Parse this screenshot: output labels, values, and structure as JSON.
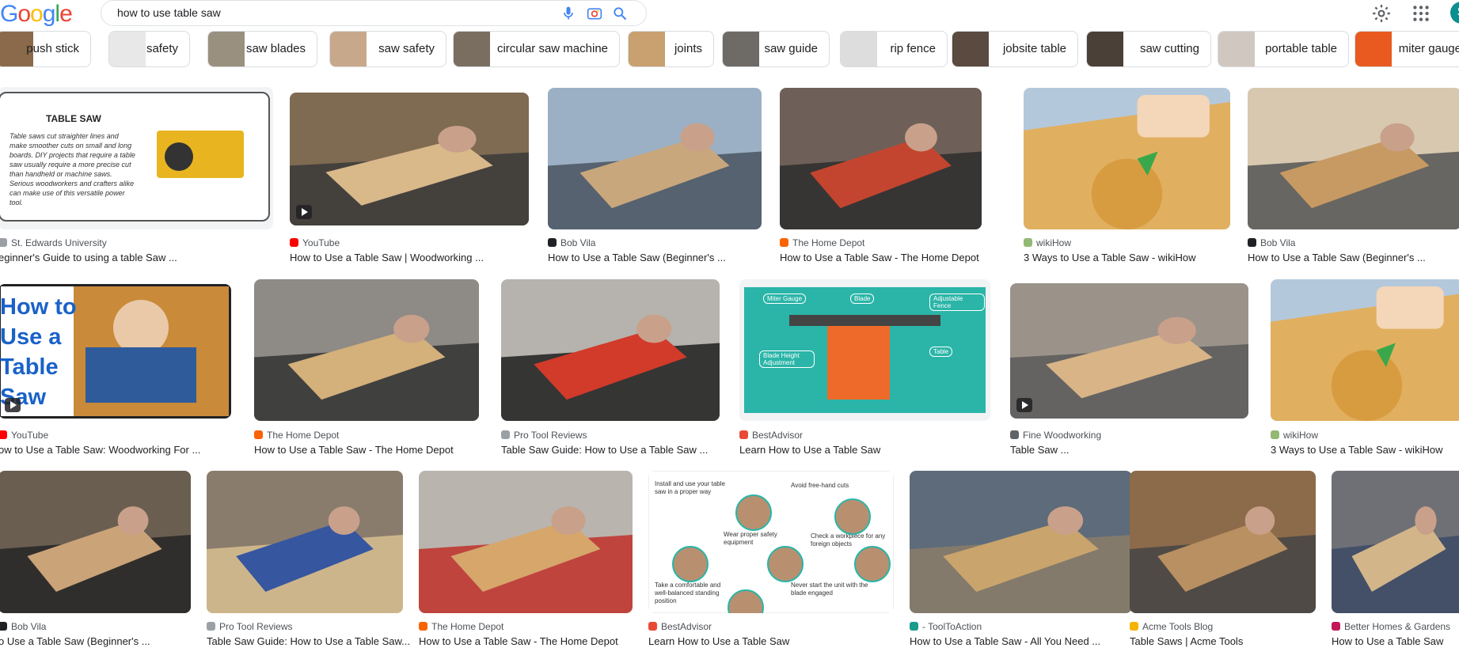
{
  "header": {
    "logo_letters": [
      "G",
      "o",
      "o",
      "g",
      "l",
      "e"
    ],
    "logo_colors": [
      "#4285f4",
      "#ea4335",
      "#fbbc05",
      "#4285f4",
      "#34a853",
      "#ea4335"
    ],
    "search_value": "how to use table saw",
    "avatar_letter": "S",
    "icons": [
      "mic-icon",
      "camera-search-icon",
      "search-icon",
      "gear-icon",
      "apps-grid-icon"
    ]
  },
  "chips": [
    {
      "label": "push stick"
    },
    {
      "label": "safety"
    },
    {
      "label": "saw blades"
    },
    {
      "label": "saw safety"
    },
    {
      "label": "circular saw machine"
    },
    {
      "label": "joints"
    },
    {
      "label": "saw guide"
    },
    {
      "label": "rip fence"
    },
    {
      "label": "jobsite table"
    },
    {
      "label": "saw cutting"
    },
    {
      "label": "portable table"
    },
    {
      "label": "miter gauge"
    }
  ],
  "results": [
    {
      "source": "St. Edwards University",
      "title": "eginner's Guide to using a table Saw ...",
      "favicon": "#9aa0a6"
    },
    {
      "source": "YouTube",
      "title": "How to Use a Table Saw | Woodworking ...",
      "favicon": "#ff0000"
    },
    {
      "source": "Bob Vila",
      "title": "How to Use a Table Saw (Beginner's ...",
      "favicon": "#202124"
    },
    {
      "source": "The Home Depot",
      "title": "How to Use a Table Saw - The Home Depot",
      "favicon": "#f96302"
    },
    {
      "source": "wikiHow",
      "title": "3 Ways to Use a Table Saw - wikiHow",
      "favicon": "#93b874"
    },
    {
      "source": "Bob Vila",
      "title": "How to Use a Table Saw (Beginner's ...",
      "favicon": "#202124"
    },
    {
      "source": "YouTube",
      "title": "ow to Use a Table Saw: Woodworking For ...",
      "favicon": "#ff0000",
      "overlay_text": [
        "How to",
        "Use a",
        "Table",
        "Saw"
      ]
    },
    {
      "source": "The Home Depot",
      "title": "How to Use a Table Saw - The Home Depot",
      "favicon": "#f96302"
    },
    {
      "source": "Pro Tool Reviews",
      "title": "Table Saw Guide: How to Use a Table Saw ...",
      "favicon": "#9aa0a6"
    },
    {
      "source": "BestAdvisor",
      "title": "Learn How to Use a Table Saw",
      "favicon": "#e94a35"
    },
    {
      "source": "Fine Woodworking",
      "title": "Table Saw ...",
      "favicon": "#5f6368"
    },
    {
      "source": "wikiHow",
      "title": "3 Ways to Use a Table Saw - wikiHow",
      "favicon": "#93b874"
    },
    {
      "source": "Bob Vila",
      "title": "o Use a Table Saw (Beginner's ...",
      "favicon": "#202124"
    },
    {
      "source": "Pro Tool Reviews",
      "title": "Table Saw Guide: How to Use a Table Saw...",
      "favicon": "#9aa0a6"
    },
    {
      "source": "The Home Depot",
      "title": "How to Use a Table Saw - The Home Depot",
      "favicon": "#f96302"
    },
    {
      "source": "BestAdvisor",
      "title": "Learn How to Use a Table Saw",
      "favicon": "#e94a35"
    },
    {
      "source": "- ToolToAction",
      "title": "How to Use a Table Saw - All You Need ...",
      "favicon": "#1a9b8c"
    },
    {
      "source": "Acme Tools Blog",
      "title": "Table Saws | Acme Tools",
      "favicon": "#f4b400"
    },
    {
      "source": "Better Homes & Gardens",
      "title": "How to Use a Table Saw",
      "favicon": "#c2185b"
    }
  ],
  "diagrams": {
    "st_edwards": {
      "heading": "TABLE SAW",
      "body": "Table saws cut straighter lines and make smoother cuts on small and long boards. DIY projects that require a table saw usually require a more precise cut than handheld or machine saws. Serious woodworkers and crafters alike can make use of this versatile power tool."
    },
    "bestadvisor_labels": [
      "Miter Gauge",
      "Blade",
      "Adjustable Fence",
      "Blade Height Adjustment",
      "Table"
    ],
    "bestadvisor_tips": [
      "Install and use your table saw in a proper way",
      "Avoid free-hand cuts",
      "Wear proper safety equipment",
      "Check a workpiece for any foreign objects",
      "Take a comfortable and well-balanced standing position",
      "Never start the unit with the blade engaged"
    ]
  }
}
